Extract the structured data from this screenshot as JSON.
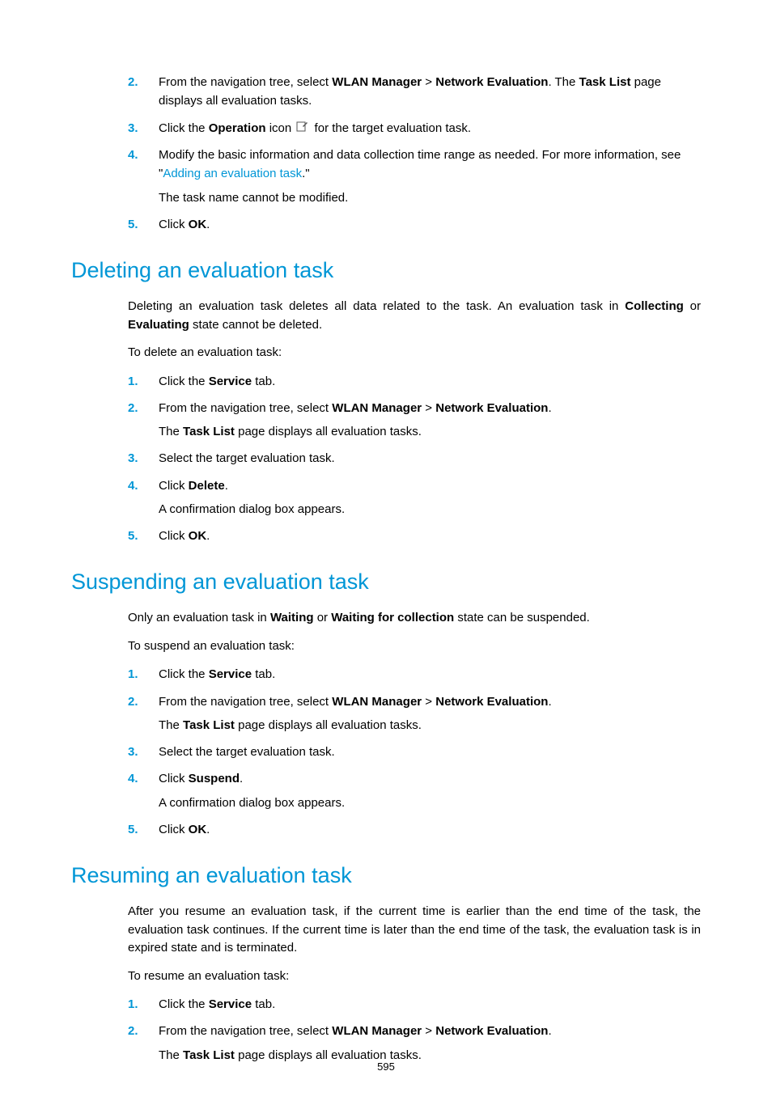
{
  "top_list": {
    "item2": {
      "num": "2.",
      "pre": "From the navigation tree, select ",
      "b1": "WLAN Manager",
      "gt": " > ",
      "b2": "Network Evaluation",
      "mid": ". The ",
      "b3": "Task List",
      "post": " page displays all evaluation tasks."
    },
    "item3": {
      "num": "3.",
      "pre": "Click the ",
      "b1": "Operation",
      "mid": " icon ",
      "post": " for the target evaluation task."
    },
    "item4": {
      "num": "4.",
      "line1": "Modify the basic information and data collection time range as needed. For more information, see \"",
      "link": "Adding an evaluation task",
      "line1_end": ".\"",
      "sub": "The task name cannot be modified."
    },
    "item5": {
      "num": "5.",
      "pre": "Click ",
      "b1": "OK",
      "post": "."
    }
  },
  "sec_delete": {
    "heading": "Deleting an evaluation task",
    "intro_pre": "Deleting an evaluation task deletes all data related to the task. An evaluation task in ",
    "intro_b1": "Collecting",
    "intro_mid": " or ",
    "intro_b2": "Evaluating",
    "intro_post": " state cannot be deleted.",
    "lead": "To delete an evaluation task:",
    "i1": {
      "num": "1.",
      "pre": "Click the ",
      "b1": "Service",
      "post": " tab."
    },
    "i2": {
      "num": "2.",
      "pre": "From the navigation tree, select ",
      "b1": "WLAN Manager",
      "gt": " > ",
      "b2": "Network Evaluation",
      "post": ".",
      "sub_pre": "The ",
      "sub_b": "Task List",
      "sub_post": " page displays all evaluation tasks."
    },
    "i3": {
      "num": "3.",
      "text": "Select the target evaluation task."
    },
    "i4": {
      "num": "4.",
      "pre": "Click ",
      "b1": "Delete",
      "post": ".",
      "sub": "A confirmation dialog box appears."
    },
    "i5": {
      "num": "5.",
      "pre": "Click ",
      "b1": "OK",
      "post": "."
    }
  },
  "sec_suspend": {
    "heading": "Suspending an evaluation task",
    "intro_pre": "Only an evaluation task in ",
    "intro_b1": "Waiting",
    "intro_mid": " or ",
    "intro_b2": "Waiting for collection",
    "intro_post": " state can be suspended.",
    "lead": "To suspend an evaluation task:",
    "i1": {
      "num": "1.",
      "pre": "Click the ",
      "b1": "Service",
      "post": " tab."
    },
    "i2": {
      "num": "2.",
      "pre": "From the navigation tree, select ",
      "b1": "WLAN Manager",
      "gt": " > ",
      "b2": "Network Evaluation",
      "post": ".",
      "sub_pre": "The ",
      "sub_b": "Task List",
      "sub_post": " page displays all evaluation tasks."
    },
    "i3": {
      "num": "3.",
      "text": "Select the target evaluation task."
    },
    "i4": {
      "num": "4.",
      "pre": "Click ",
      "b1": "Suspend",
      "post": ".",
      "sub": "A confirmation dialog box appears."
    },
    "i5": {
      "num": "5.",
      "pre": "Click ",
      "b1": "OK",
      "post": "."
    }
  },
  "sec_resume": {
    "heading": "Resuming an evaluation task",
    "intro": "After you resume an evaluation task, if the current time is earlier than the end time of the task, the evaluation task continues. If the current time is later than the end time of the task, the evaluation task is in expired state and is terminated.",
    "lead": "To resume an evaluation task:",
    "i1": {
      "num": "1.",
      "pre": "Click the ",
      "b1": "Service",
      "post": " tab."
    },
    "i2": {
      "num": "2.",
      "pre": "From the navigation tree, select ",
      "b1": "WLAN Manager",
      "gt": " > ",
      "b2": "Network Evaluation",
      "post": ".",
      "sub_pre": "The ",
      "sub_b": "Task List",
      "sub_post": " page displays all evaluation tasks."
    }
  },
  "page_number": "595"
}
